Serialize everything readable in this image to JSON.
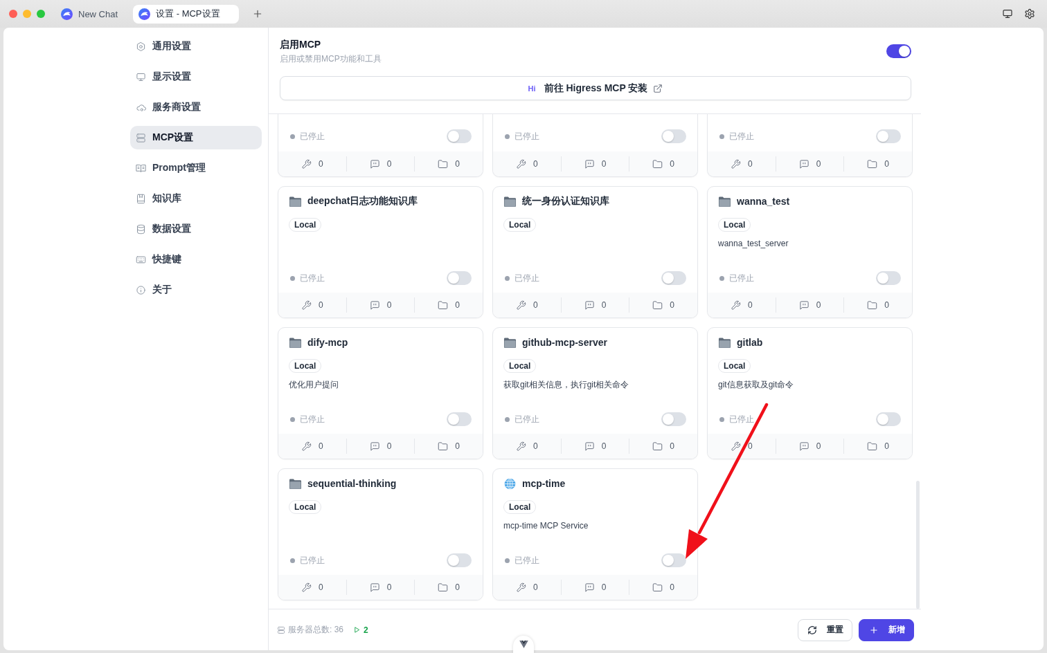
{
  "titlebar": {
    "tabs": [
      {
        "title": "New Chat",
        "selected": false
      },
      {
        "title": "设置 - MCP设置",
        "selected": true
      }
    ]
  },
  "sidebar": {
    "items": [
      {
        "label": "通用设置",
        "selected": false
      },
      {
        "label": "显示设置",
        "selected": false
      },
      {
        "label": "服务商设置",
        "selected": false
      },
      {
        "label": "MCP设置",
        "selected": true
      },
      {
        "label": "Prompt管理",
        "selected": false
      },
      {
        "label": "知识库",
        "selected": false
      },
      {
        "label": "数据设置",
        "selected": false
      },
      {
        "label": "快捷键",
        "selected": false
      },
      {
        "label": "关于",
        "selected": false
      }
    ]
  },
  "mcp_header": {
    "title": "启用MCP",
    "subtitle": "启用或禁用MCP功能和工具",
    "on": true
  },
  "install_button": {
    "logo": "Hi",
    "label": "前往 Higress MCP 安装"
  },
  "cut_cards": [
    {
      "status": "已停止",
      "running": false,
      "on": false,
      "tools": "0",
      "prompts": "0",
      "resources": "0"
    },
    {
      "status": "已停止",
      "running": false,
      "on": false,
      "tools": "0",
      "prompts": "0",
      "resources": "0"
    },
    {
      "status": "已停止",
      "running": false,
      "on": false,
      "tools": "0",
      "prompts": "0",
      "resources": "0"
    }
  ],
  "cards": [
    {
      "kind": "folder",
      "name": "deepchat日志功能知识库",
      "tag": "Local",
      "status": "已停止",
      "running": false,
      "on": false,
      "tools": "0",
      "prompts": "0",
      "resources": "0"
    },
    {
      "kind": "folder",
      "name": "统一身份认证知识库",
      "tag": "Local",
      "status": "已停止",
      "running": false,
      "on": false,
      "tools": "0",
      "prompts": "0",
      "resources": "0"
    },
    {
      "kind": "folder",
      "name": "wanna_test",
      "tag": "Local",
      "description": "wanna_test_server",
      "status": "已停止",
      "running": false,
      "on": false,
      "tools": "0",
      "prompts": "0",
      "resources": "0"
    },
    {
      "kind": "folder",
      "name": "dify-mcp",
      "tag": "Local",
      "description": "优化用户提问",
      "status": "已停止",
      "running": false,
      "on": false,
      "tools": "0",
      "prompts": "0",
      "resources": "0"
    },
    {
      "kind": "folder",
      "name": "github-mcp-server",
      "tag": "Local",
      "description": "获取git相关信息，执行git相关命令",
      "status": "已停止",
      "running": false,
      "on": false,
      "tools": "0",
      "prompts": "0",
      "resources": "0"
    },
    {
      "kind": "folder",
      "name": "gitlab",
      "tag": "Local",
      "description": "git信息获取及git命令",
      "status": "已停止",
      "running": false,
      "on": false,
      "tools": "0",
      "prompts": "0",
      "resources": "0"
    },
    {
      "kind": "folder",
      "name": "sequential-thinking",
      "tag": "Local",
      "status": "已停止",
      "running": false,
      "on": false,
      "tools": "0",
      "prompts": "0",
      "resources": "0"
    },
    {
      "kind": "globe",
      "name": "mcp-time",
      "tag": "Local",
      "description": "mcp-time MCP Service",
      "status": "已停止",
      "running": false,
      "on": false,
      "tools": "0",
      "prompts": "0",
      "resources": "0"
    }
  ],
  "footer": {
    "total": "服务器总数: 36",
    "running": "2",
    "buttons": [
      {
        "kind": "reset",
        "label": "重置"
      },
      {
        "kind": "add",
        "label": "新增"
      }
    ]
  }
}
